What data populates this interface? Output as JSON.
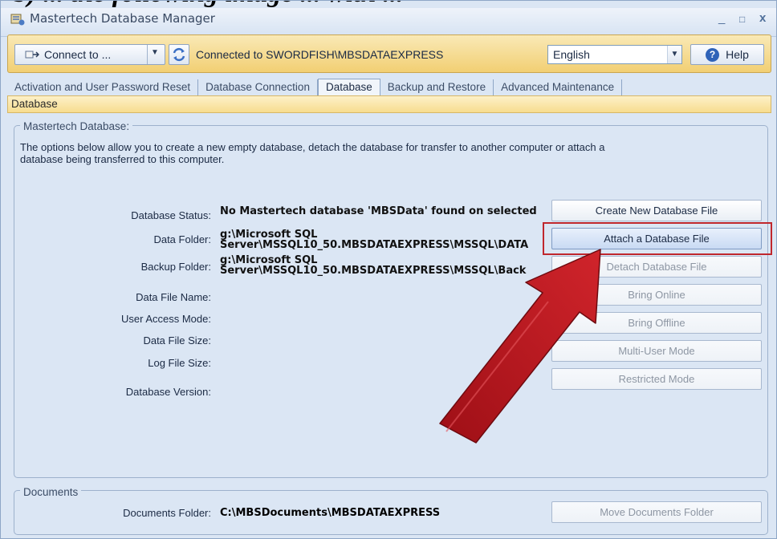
{
  "top_crop_text": "b) ... the following image ... with ...",
  "window": {
    "title": "Mastertech Database Manager",
    "controls": {
      "minimize": "_",
      "maximize": "□",
      "close": "x"
    }
  },
  "toolbar": {
    "connect_label": "Connect to ...",
    "connection_status": "Connected to SWORDFISH\\MBSDATAEXPRESS",
    "language_value": "English",
    "help_label": "Help"
  },
  "tabs": [
    {
      "label": "Activation and User Password Reset"
    },
    {
      "label": "Database Connection"
    },
    {
      "label": "Database",
      "active": true
    },
    {
      "label": "Backup and Restore"
    },
    {
      "label": "Advanced Maintenance"
    }
  ],
  "section_title": "Database",
  "main_group": {
    "legend": "Mastertech Database:",
    "description": "The options below allow you to create a new empty database, detach the database for transfer to another computer or attach a database being transferred to this computer.",
    "fields": [
      {
        "label": "Database Status:",
        "value": "No Mastertech database 'MBSData' found on selected"
      },
      {
        "label": "Data Folder:",
        "value_line1": "g:\\Microsoft SQL",
        "value_line2": "Server\\MSSQL10_50.MBSDATAEXPRESS\\MSSQL\\DATA"
      },
      {
        "label": "Backup Folder:",
        "value_line1": "g:\\Microsoft SQL",
        "value_line2": "Server\\MSSQL10_50.MBSDATAEXPRESS\\MSSQL\\Back"
      },
      {
        "label": "Data File Name:",
        "value": ""
      },
      {
        "label": "User Access Mode:",
        "value": ""
      },
      {
        "label": "Data File Size:",
        "value": ""
      },
      {
        "label": "Log File Size:",
        "value": ""
      },
      {
        "label": "Database Version:",
        "value": ""
      }
    ],
    "buttons": [
      {
        "label": "Create New Database File",
        "enabled": true
      },
      {
        "label": "Attach a Database File",
        "enabled": true,
        "highlighted": true
      },
      {
        "label": "Detach Database File",
        "enabled": false
      },
      {
        "label": "Bring Online",
        "enabled": false
      },
      {
        "label": "Bring Offline",
        "enabled": false
      },
      {
        "label": "Multi-User Mode",
        "enabled": false
      },
      {
        "label": "Restricted Mode",
        "enabled": false
      }
    ]
  },
  "documents_group": {
    "legend": "Documents",
    "folder_label": "Documents Folder:",
    "folder_value": "C:\\MBSDocuments\\MBSDATAEXPRESS",
    "move_button": "Move Documents Folder"
  },
  "colors": {
    "toolbar_gold": "#f2cf73",
    "panel_blue": "#dbe6f4",
    "highlight_red": "#c0272d",
    "arrow_red": "#b5121b"
  }
}
